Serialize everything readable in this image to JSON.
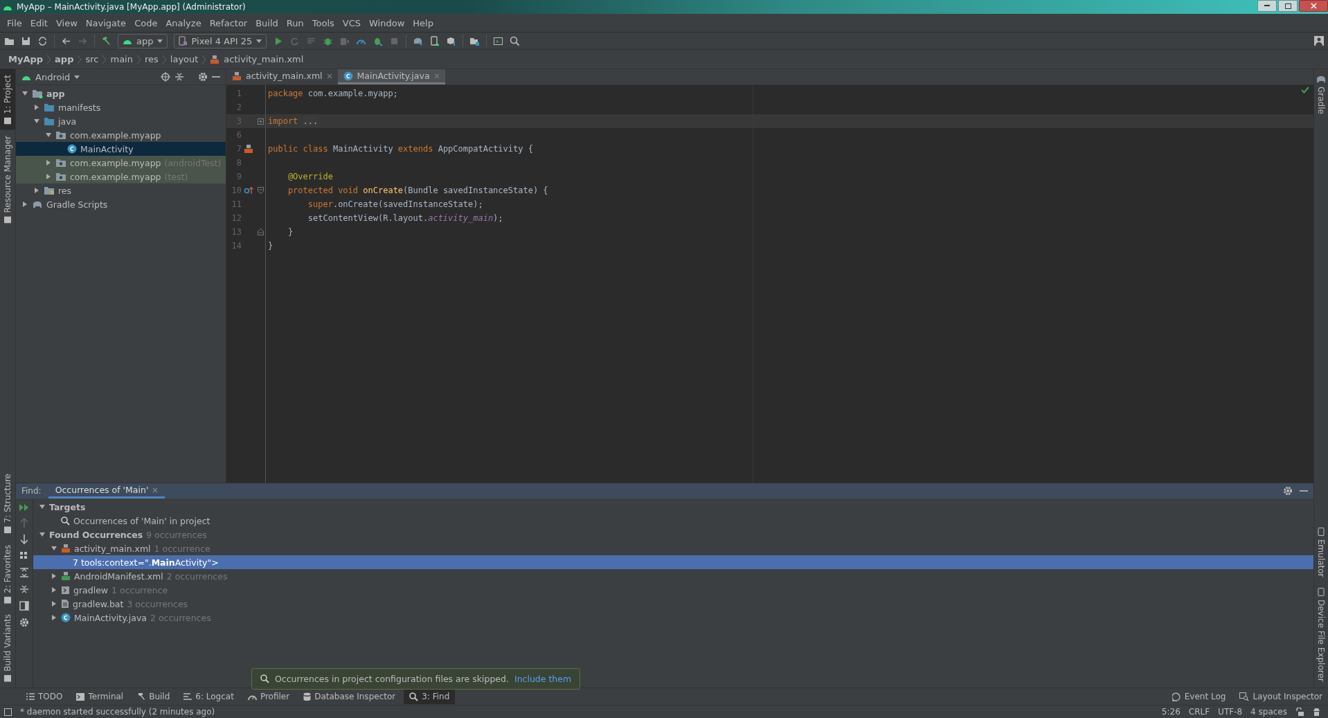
{
  "window": {
    "title": "MyApp – MainActivity.java [MyApp.app] (Administrator)"
  },
  "menu": [
    "File",
    "Edit",
    "View",
    "Navigate",
    "Code",
    "Analyze",
    "Refactor",
    "Build",
    "Run",
    "Tools",
    "VCS",
    "Window",
    "Help"
  ],
  "toolbar": {
    "module": "app",
    "device": "Pixel 4 API 25"
  },
  "breadcrumb": [
    {
      "label": "MyApp",
      "kind": "root"
    },
    {
      "label": "app",
      "kind": "module"
    },
    {
      "label": "src",
      "kind": "dir"
    },
    {
      "label": "main",
      "kind": "dir"
    },
    {
      "label": "res",
      "kind": "dir"
    },
    {
      "label": "layout",
      "kind": "dir"
    },
    {
      "label": "activity_main.xml",
      "kind": "xml"
    }
  ],
  "left_strip": {
    "top": [
      {
        "label": "1: Project",
        "selected": true
      },
      {
        "label": "Resource Manager",
        "selected": false
      }
    ],
    "bottom": [
      {
        "label": "7: Structure",
        "selected": false
      },
      {
        "label": "2: Favorites",
        "selected": false
      },
      {
        "label": "Build Variants",
        "selected": false
      }
    ]
  },
  "right_strip": {
    "top": [
      {
        "label": "Gradle"
      }
    ],
    "bottom": [
      {
        "label": "Emulator"
      },
      {
        "label": "Device File Explorer"
      }
    ]
  },
  "project": {
    "view": "Android",
    "tree": [
      {
        "label": "app",
        "kind": "module",
        "expanded": true,
        "selected": false,
        "tinted": false,
        "children": [
          {
            "label": "manifests",
            "kind": "folder",
            "expanded": false,
            "selected": false,
            "tinted": false
          },
          {
            "label": "java",
            "kind": "folder",
            "expanded": true,
            "selected": false,
            "tinted": false,
            "children": [
              {
                "label": "com.example.myapp",
                "kind": "package",
                "expanded": true,
                "selected": false,
                "tinted": false,
                "children": [
                  {
                    "label": "MainActivity",
                    "kind": "class",
                    "selected": true,
                    "tinted": false
                  }
                ]
              },
              {
                "label": "com.example.myapp",
                "suffix": "(androidTest)",
                "kind": "package",
                "expanded": false,
                "selected": false,
                "tinted": true
              },
              {
                "label": "com.example.myapp",
                "suffix": "(test)",
                "kind": "package",
                "expanded": false,
                "selected": false,
                "tinted": true
              }
            ]
          },
          {
            "label": "res",
            "kind": "res",
            "expanded": false,
            "selected": false,
            "tinted": false
          }
        ]
      },
      {
        "label": "Gradle Scripts",
        "kind": "gradle",
        "expanded": false,
        "selected": false,
        "tinted": false
      }
    ]
  },
  "tabs": [
    {
      "label": "activity_main.xml",
      "kind": "xml",
      "selected": false
    },
    {
      "label": "MainActivity.java",
      "kind": "class",
      "selected": true
    }
  ],
  "code": [
    {
      "number": "1",
      "highlighted": false,
      "tokens": [
        {
          "text": "package",
          "kind": "keyword"
        },
        {
          "text": " com.example.myapp;",
          "kind": "plain"
        }
      ]
    },
    {
      "number": "2",
      "highlighted": false
    },
    {
      "number": "3",
      "highlighted": true,
      "markers": [
        {
          "kind": "fold-collapsed"
        }
      ],
      "tokens": [
        {
          "text": "import ",
          "kind": "keyword"
        },
        {
          "text": "...",
          "kind": "folded"
        }
      ]
    },
    {
      "number": "6",
      "highlighted": false
    },
    {
      "number": "7",
      "highlighted": false,
      "markers": [
        {
          "kind": "layout"
        }
      ],
      "tokens": [
        {
          "text": "public class",
          "kind": "keyword"
        },
        {
          "text": " MainActivity ",
          "kind": "plain"
        },
        {
          "text": "extends",
          "kind": "keyword"
        },
        {
          "text": " AppCompatActivity {",
          "kind": "plain"
        }
      ]
    },
    {
      "number": "8",
      "highlighted": false
    },
    {
      "number": "9",
      "highlighted": false,
      "tokens": [
        {
          "text": "    @Override",
          "kind": "annotation"
        }
      ]
    },
    {
      "number": "10",
      "highlighted": false,
      "markers": [
        {
          "kind": "override"
        },
        {
          "kind": "fold-start"
        }
      ],
      "tokens": [
        {
          "text": "    protected void ",
          "kind": "keyword"
        },
        {
          "text": "onCreate",
          "kind": "method"
        },
        {
          "text": "(Bundle savedInstanceState) {",
          "kind": "plain"
        }
      ]
    },
    {
      "number": "11",
      "highlighted": false,
      "tokens": [
        {
          "text": "        super",
          "kind": "keyword"
        },
        {
          "text": ".onCreate(savedInstanceState);",
          "kind": "plain"
        }
      ]
    },
    {
      "number": "12",
      "highlighted": false,
      "tokens": [
        {
          "text": "        setContentView(R.layout.",
          "kind": "plain"
        },
        {
          "text": "activity_main",
          "kind": "field"
        },
        {
          "text": ");",
          "kind": "plain"
        }
      ]
    },
    {
      "number": "13",
      "highlighted": false,
      "markers": [
        {
          "kind": "fold-end"
        }
      ],
      "tokens": [
        {
          "text": "    }",
          "kind": "plain"
        }
      ]
    },
    {
      "number": "14",
      "highlighted": false,
      "tokens": [
        {
          "text": "}",
          "kind": "plain"
        }
      ]
    }
  ],
  "find": {
    "label": "Find:",
    "tab": "Occurrences of 'Main'",
    "tree": [
      {
        "label": "Targets",
        "kind": "group",
        "expanded": true,
        "selected": false,
        "children": [
          {
            "label": "Occurrences of 'Main' in project",
            "kind": "search",
            "selected": false
          }
        ]
      },
      {
        "label": "Found Occurrences",
        "count": "9 occurrences",
        "kind": "group",
        "expanded": true,
        "selected": false,
        "children": [
          {
            "label": "activity_main.xml",
            "count": "1 occurrence",
            "kind": "xml",
            "expanded": true,
            "selected": false,
            "children": [
              {
                "label": "7 tools:context=\".**Main**Activity\">",
                "kind": "match",
                "selected": true
              }
            ]
          },
          {
            "label": "AndroidManifest.xml",
            "count": "2 occurrences",
            "kind": "manifest",
            "expanded": false,
            "selected": false
          },
          {
            "label": "gradlew",
            "count": "1 occurrence",
            "kind": "script",
            "expanded": false,
            "selected": false
          },
          {
            "label": "gradlew.bat",
            "count": "3 occurrences",
            "kind": "text",
            "expanded": false,
            "selected": false
          },
          {
            "label": "MainActivity.java",
            "count": "2 occurrences",
            "kind": "class",
            "expanded": false,
            "selected": false
          }
        ]
      }
    ],
    "notice": {
      "text": "Occurrences in project configuration files are skipped.",
      "link": "Include them"
    }
  },
  "tool_windows": {
    "left": [
      {
        "label": "TODO",
        "kind": "list",
        "selected": false
      },
      {
        "label": "Terminal",
        "kind": "terminal",
        "selected": false
      },
      {
        "label": "Build",
        "kind": "hammer",
        "selected": false
      },
      {
        "label": "6: Logcat",
        "kind": "lines",
        "selected": false
      },
      {
        "label": "Profiler",
        "kind": "gauge",
        "selected": false
      },
      {
        "label": "Database Inspector",
        "kind": "database",
        "selected": false
      },
      {
        "label": "3: Find",
        "kind": "search",
        "selected": true
      }
    ],
    "right": [
      {
        "label": "Event Log",
        "kind": "bubble",
        "selected": false
      },
      {
        "label": "Layout Inspector",
        "kind": "inspector",
        "selected": false
      }
    ]
  },
  "status_bar": {
    "message": "* daemon started successfully (2 minutes ago)",
    "items": [
      "5:26",
      "CRLF",
      "UTF-8",
      "4 spaces"
    ]
  }
}
